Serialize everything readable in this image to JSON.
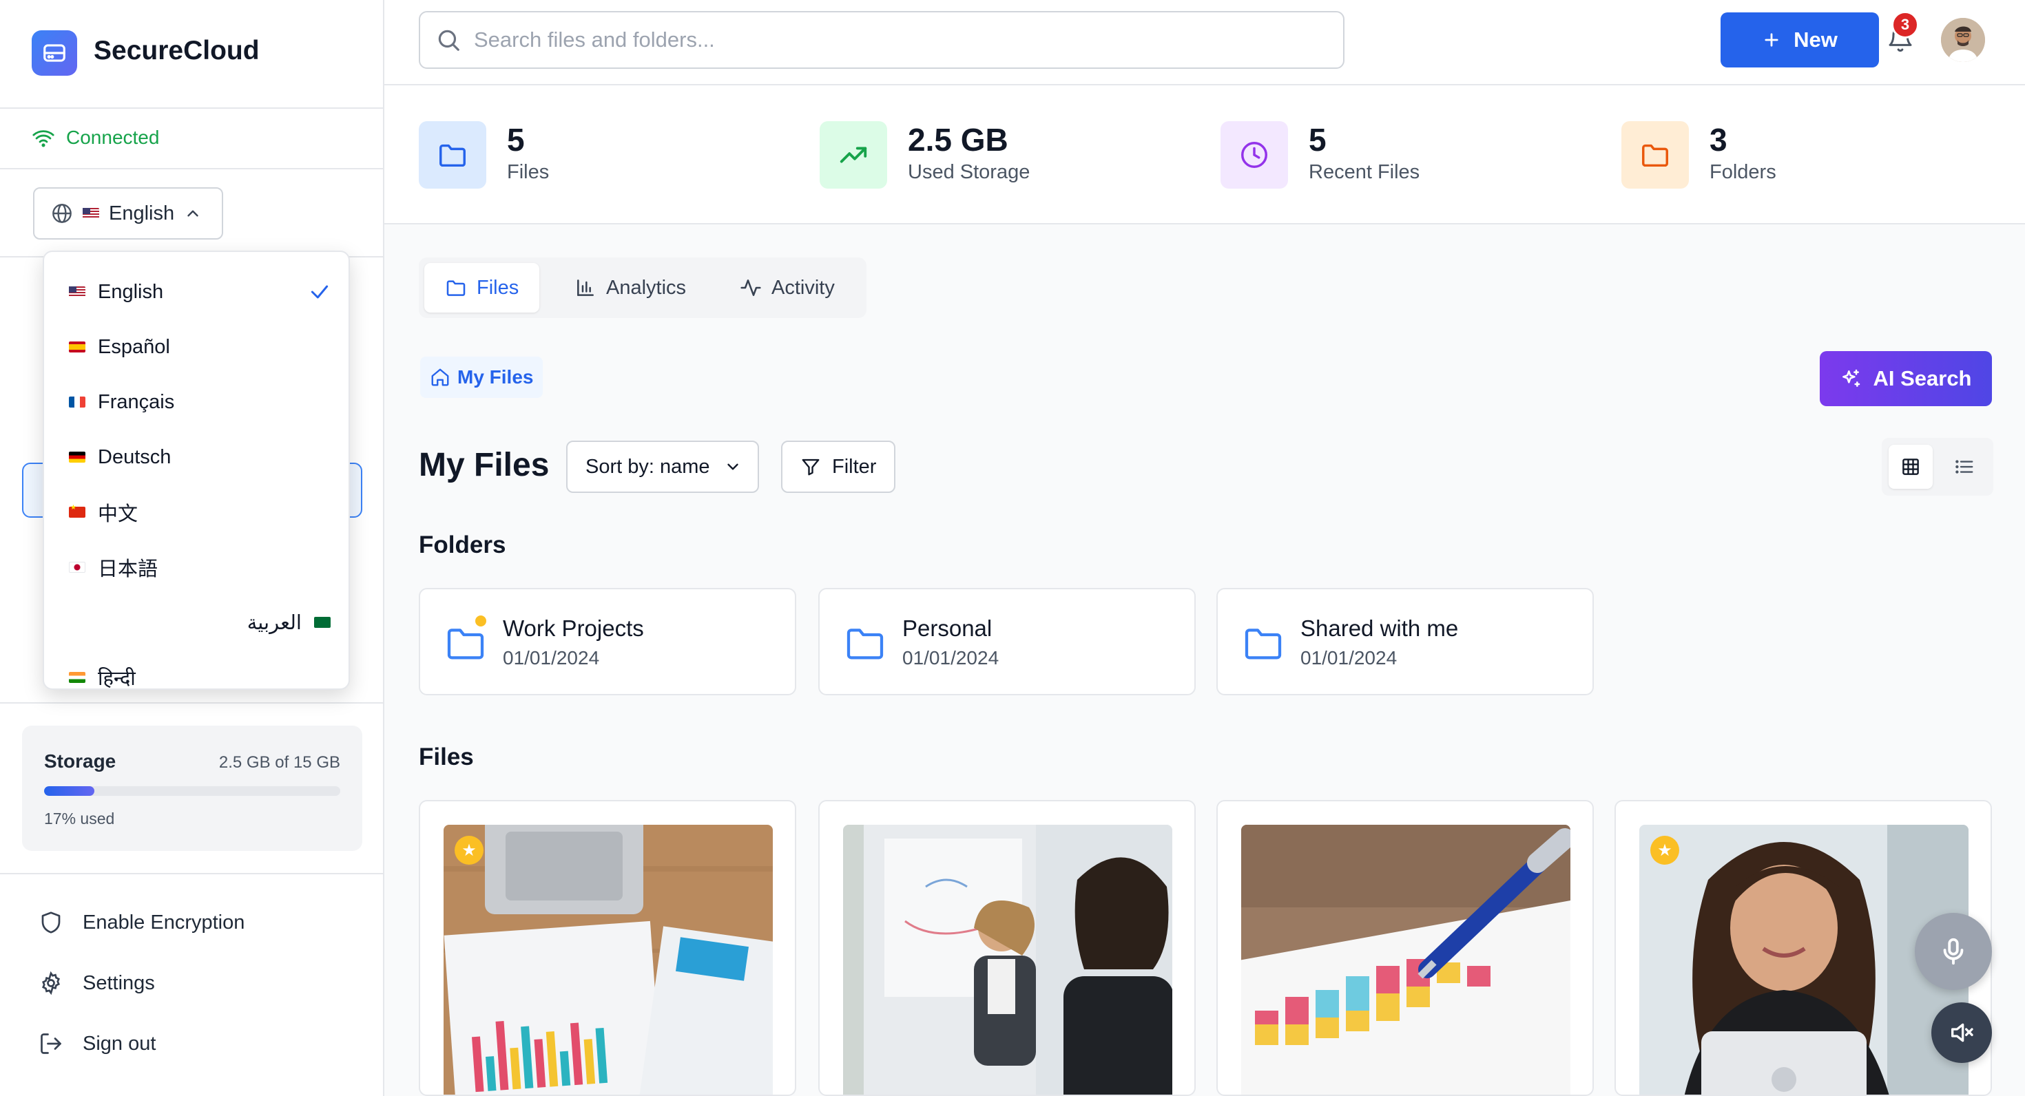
{
  "brand": {
    "name": "SecureCloud"
  },
  "connection": {
    "status": "Connected"
  },
  "language": {
    "current": "English",
    "options": [
      {
        "label": "English",
        "flag": "us",
        "selected": true
      },
      {
        "label": "Español",
        "flag": "es"
      },
      {
        "label": "Français",
        "flag": "fr"
      },
      {
        "label": "Deutsch",
        "flag": "de"
      },
      {
        "label": "中文",
        "flag": "cn"
      },
      {
        "label": "日本語",
        "flag": "jp"
      },
      {
        "label": "العربية",
        "flag": "sa"
      },
      {
        "label": "हिन्दी",
        "flag": "in"
      }
    ]
  },
  "storage": {
    "title": "Storage",
    "amount": "2.5 GB of 15 GB",
    "used_label": "17% used",
    "used_fraction": 0.17
  },
  "sidebar_bottom": {
    "encryption": "Enable Encryption",
    "settings": "Settings",
    "signout": "Sign out"
  },
  "search": {
    "placeholder": "Search files and folders..."
  },
  "topbar": {
    "new_label": "New",
    "notifications": "3"
  },
  "stats": [
    {
      "value": "5",
      "label": "Files",
      "icon": "folder-icon",
      "color": "#2563eb"
    },
    {
      "value": "2.5 GB",
      "label": "Used Storage",
      "icon": "trending-up-icon",
      "color": "#16a34a"
    },
    {
      "value": "5",
      "label": "Recent Files",
      "icon": "clock-icon",
      "color": "#9333ea"
    },
    {
      "value": "3",
      "label": "Folders",
      "icon": "folder-icon",
      "color": "#ea580c"
    }
  ],
  "tabs": {
    "files": "Files",
    "analytics": "Analytics",
    "activity": "Activity"
  },
  "breadcrumb": {
    "home": "My Files"
  },
  "ai_search": {
    "label": "AI Search"
  },
  "main": {
    "title": "My Files",
    "sort_label": "Sort by: name",
    "filter_label": "Filter",
    "folders_title": "Folders",
    "files_title": "Files"
  },
  "folders": [
    {
      "name": "Work Projects",
      "date": "01/01/2024",
      "starred": true
    },
    {
      "name": "Personal",
      "date": "01/01/2024",
      "starred": false
    },
    {
      "name": "Shared with me",
      "date": "01/01/2024",
      "starred": false
    }
  ],
  "files": [
    {
      "thumbnail": "charts-on-desk",
      "starred": true
    },
    {
      "thumbnail": "team-whiteboard",
      "starred": false
    },
    {
      "thumbnail": "bar-chart-pen",
      "starred": false
    },
    {
      "thumbnail": "woman-laptop",
      "starred": true
    }
  ],
  "colors": {
    "accent": "#2563eb",
    "ai": "#7c3aed",
    "success": "#16a34a"
  }
}
